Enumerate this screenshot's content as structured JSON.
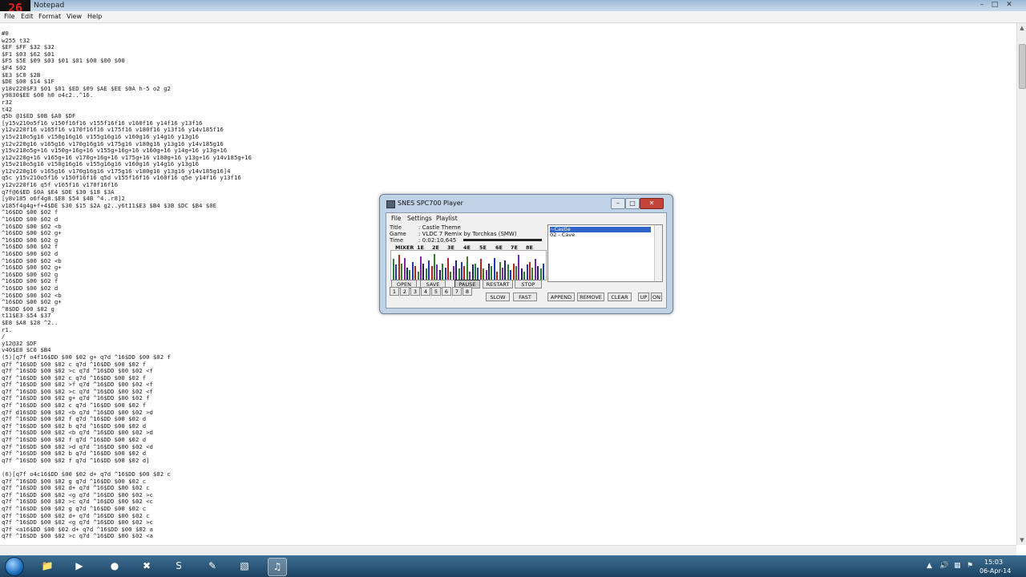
{
  "window": {
    "badge": "26",
    "title": "Notepad"
  },
  "menubar": {
    "items": [
      "File",
      "Edit",
      "Format",
      "View",
      "Help"
    ]
  },
  "editor": {
    "lines": [
      "#0",
      "w255 t32",
      "$EF $FF $32 $32",
      "$F1 $03 $62 $01",
      "$F5 $5E $09 $03 $01 $01 $00 $00 $00",
      "$F4 $02",
      "$E3 $C0 $2B",
      "$DE $00 $14 $1F",
      "y18v220$F3 $01 $01 $ED $09 $AE $EE $0A h-5 o2 g2",
      "y9830$EE $00 h0 o4c2..^16.",
      "r32",
      "t42",
      "q5b @1$ED $0B $A0 $DF",
      "[y15v210o5f16 v150f16f16 v155f16f16 v160f16 y14f16 y13f16",
      "y12v220f16 v165f16 v170f16f16 v175f16 v180f16 y13f16 y14v185f16",
      "y15v210o5g16 v150g16g16 v155g16g16 v160g16 y14g16 y13g16",
      "y12v220g16 v165g16 v170g16g16 v175g16 v180g16 y13g16 y14v185g16",
      "y15v210o5g+16 v150g+16g+16 v155g+16g+16 v160g+16 y14g+16 y13g+16",
      "y12v220g+16 v165g+16 v170g+16g+16 v175g+16 v180g+16 y13g+16 y14v185g+16",
      "y15v210o5g16 v150g16g16 v155g16g16 v160g16 y14g16 y13g16",
      "y12v220g16 v165g16 v170g16g16 v175g16 v180g16 y13g16 y14v185g16]4",
      "q5c y15v210o5f16 v150f16f16 q5d v155f16f16 v160f16 q5e y14f16 y13f16",
      "y12v220f16 q5f v165f16 v170f16f16",
      "q7f@6$ED $0A $E4 $DE $30 $18 $3A",
      "[y8v185 o6f4g8.$E8 $54 $4B ^4..r8]2",
      "v185f4g4g+f+4$DE $30 $15 $2A g2..y6t11$E3 $B4 $3B $DC $B4 $0E",
      "^16$DD $00 $02 f",
      "^16$DD $00 $02 d",
      "^16$DD $00 $02 <b",
      "^16$DD $00 $02 g+",
      "^16$DD $00 $02 g",
      "^16$DD $00 $02 f",
      "^16$DD $00 $02 d",
      "^16$DD $00 $02 <b",
      "^16$DD $00 $02 g+",
      "^16$DD $00 $02 g",
      "^16$DD $00 $02 f",
      "^16$DD $00 $02 d",
      "^16$DD $00 $02 <b",
      "^16$DD $00 $02 g+",
      "^8$DD $00 $02 g",
      "t11$E3 $54 $37",
      "$E8 $A8 $28 ^2..",
      "r1.",
      "/",
      "y12@32 $DF",
      "v40$E8 $C0 $B4",
      "(5)[q7f o4f16$DD $00 $02 g+ q7d ^16$DD $00 $02 f",
      "q7f ^16$DD $00 $02 c q7d ^16$DD $00 $02 f",
      "q7f ^16$DD $00 $02 >c q7d ^16$DD $00 $02 <f",
      "q7f ^16$DD $00 $02 c q7d ^16$DD $00 $02 f",
      "q7f ^16$DD $00 $02 >f q7d ^16$DD $00 $02 <f",
      "q7f ^16$DD $00 $02 >c q7d ^16$DD $00 $02 <f",
      "q7f ^16$DD $00 $02 g+ q7d ^16$DD $00 $02 f",
      "q7f ^16$DD $00 $02 c q7d ^16$DD $00 $02 f",
      "q7f d16$DD $00 $02 <b q7d ^16$DD $00 $02 >d",
      "q7f ^16$DD $00 $02 f q7d ^16$DD $00 $02 d",
      "q7f ^16$DD $00 $02 b q7d ^16$DD $00 $02 d",
      "q7f ^16$DD $00 $02 <b q7d ^16$DD $00 $02 >d",
      "q7f ^16$DD $00 $02 f q7d ^16$DD $00 $02 d",
      "q7f ^16$DD $00 $02 >d q7d ^16$DD $00 $02 <d",
      "q7f ^16$DD $00 $02 b q7d ^16$DD $00 $02 d",
      "q7f ^16$DD $00 $02 f q7d ^16$DD $00 $02 d]",
      "",
      "(6)[q7f o4c16$DD $00 $02 d+ q7d ^16$DD $00 $02 c",
      "q7f ^16$DD $00 $02 g q7d ^16$DD $00 $02 c",
      "q7f ^16$DD $00 $02 d+ q7d ^16$DD $00 $02 c",
      "q7f ^16$DD $00 $02 <g q7d ^16$DD $00 $02 >c",
      "q7f ^16$DD $00 $02 >c q7d ^16$DD $00 $02 <c",
      "q7f ^16$DD $00 $02 g q7d ^16$DD $00 $02 c",
      "q7f ^16$DD $00 $02 d+ q7d ^16$DD $00 $02 c",
      "q7f ^16$DD $00 $02 <g q7d ^16$DD $00 $02 >c",
      "q7f <a16$DD $00 $02 d+ q7d ^16$DD $00 $02 a",
      "q7f ^16$DD $00 $02 >c q7d ^16$DD $00 $02 <a"
    ]
  },
  "spc": {
    "title": "SNES SPC700 Player",
    "menu": [
      "File",
      "Settings",
      "Playlist"
    ],
    "info": {
      "title_label": "Title",
      "title_value": ": Castle Theme",
      "game_label": "Game",
      "game_value": ": VLDC 7 Remix by Torchkas (SMW)",
      "time_label": "Time",
      "time_value": ": 0:02:10.645"
    },
    "channels": [
      "MIXER",
      "1E",
      "2E",
      "3E",
      "4E",
      "5E",
      "6E",
      "7E",
      "8E"
    ],
    "playlist": [
      "~Castle",
      "02 - Cave"
    ],
    "buttons": {
      "open": "OPEN",
      "save": "SAVE",
      "pause": "PAUSE",
      "restart": "RESTART",
      "stop": "STOP",
      "slow": "SLOW",
      "fast": "FAST",
      "append": "APPEND",
      "remove": "REMOVE",
      "clear": "CLEAR",
      "up": "UP",
      "on": "ON"
    },
    "numbers": [
      "1",
      "2",
      "3",
      "4",
      "5",
      "6",
      "7",
      "8"
    ],
    "vis_levels": [
      0.75,
      0.55,
      0.9,
      0.6,
      0.8,
      0.45,
      0.35,
      0.65,
      0.5,
      0.3,
      0.85,
      0.6,
      0.4,
      0.7,
      0.5,
      0.95,
      0.55,
      0.35,
      0.6,
      0.45,
      0.8,
      0.3,
      0.5,
      0.7,
      0.4,
      0.65,
      0.5,
      0.85,
      0.3,
      0.55,
      0.6,
      0.45,
      0.75,
      0.4,
      0.35,
      0.6,
      0.5,
      0.8,
      0.3,
      0.65,
      0.45,
      0.7,
      0.55,
      0.35,
      0.6,
      0.5,
      0.9,
      0.4,
      0.3,
      0.55,
      0.65,
      0.45,
      0.75,
      0.5,
      0.4,
      0.6
    ],
    "vis_colors": [
      "#2f7d32",
      "#1f3ea8",
      "#b0261f",
      "#3a7a2a",
      "#7a2aa0",
      "#222266"
    ]
  },
  "taskbar": {
    "time": "15:03",
    "date": "06-Apr-14"
  }
}
